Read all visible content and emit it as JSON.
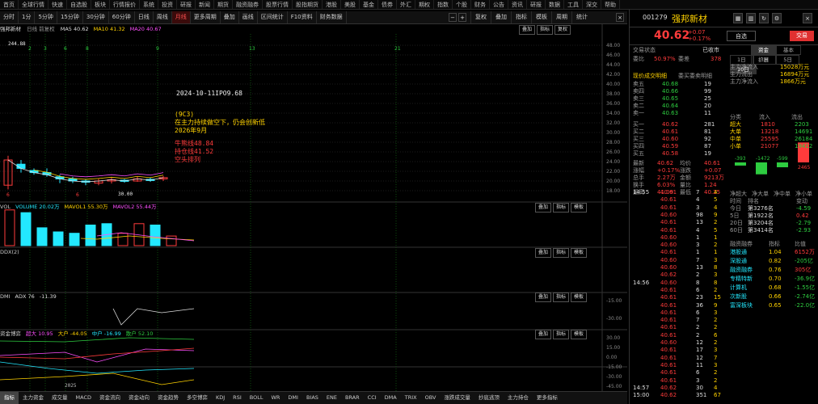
{
  "top_menu": [
    "首页",
    "全球行情",
    "快速",
    "自选股",
    "板块",
    "行情报价",
    "系统",
    "投资",
    "研报",
    "新闻",
    "期货",
    "融资融券",
    "股票行情",
    "股指期货",
    "港股",
    "美股",
    "基金",
    "债券",
    "外汇",
    "期权",
    "指数",
    "个股",
    "财务",
    "公告",
    "资讯",
    "研报",
    "数据",
    "工具",
    "深交",
    "帮助"
  ],
  "toolbar": {
    "items": [
      "分时",
      "1分",
      "5分钟",
      "15分钟",
      "30分钟",
      "60分钟",
      "日线",
      "周线",
      "月线",
      "更多周期",
      "叠加",
      "画线",
      "区间统计",
      "F10资料",
      "财务数据"
    ],
    "active_index": 8,
    "right_items": [
      "复权",
      "叠加",
      "指标",
      "模板",
      "周期",
      "统计"
    ]
  },
  "main_panel": {
    "title": "强邦新材",
    "subtitle": "日线 前复权",
    "ma_labels": [
      {
        "t": "MA5 40.62",
        "c": "#ddd"
      },
      {
        "t": "MA10 41.32",
        "c": "#ffd200"
      },
      {
        "t": "MA20 40.67",
        "c": "#ff4fff"
      }
    ],
    "right_tools": [
      "叠加",
      "指标",
      "复权"
    ],
    "price_axis": [
      "48.00",
      "46.00",
      "44.00",
      "42.00",
      "40.00",
      "38.00",
      "36.00",
      "34.00",
      "32.00",
      "30.00",
      "28.00",
      "26.00",
      "24.00",
      "22.00",
      "20.00",
      "18.00"
    ]
  },
  "annotations": {
    "ipo": "2024-10-11IPO9.68",
    "q_title": "(9C3)",
    "q_line1": "在主力持续做空下，仍会创新低",
    "q_line2": "2026年9月",
    "bear_line": "牛熊线48.84",
    "hold_line": "持仓线41.52",
    "bias": "空头排列",
    "high_label": "244.88",
    "low_label": "30.00",
    "month_markers": [
      "2",
      "3",
      "6",
      "8",
      "9",
      "13",
      "21"
    ]
  },
  "volume_panel": {
    "head": [
      {
        "t": "VOL",
        "c": "#ccc"
      },
      {
        "t": "VOLUME 20.02万",
        "c": "#23e8ff"
      },
      {
        "t": "MAVOL1 55.30万",
        "c": "#ffd200"
      },
      {
        "t": "MAVOL2 55.44万",
        "c": "#ff4fff"
      }
    ],
    "tools": [
      "叠加",
      "指标",
      "模板"
    ]
  },
  "empty_panel": {
    "head": [
      {
        "t": "DDX(2)",
        "c": "#ccc"
      }
    ],
    "tools": [
      "叠加",
      "指标",
      "模板"
    ]
  },
  "index_panel": {
    "head": [
      {
        "t": "DMI",
        "c": "#ccc"
      },
      {
        "t": "ADX 76",
        "c": "#ddd"
      },
      {
        "t": "-11.39",
        "c": "#ddd"
      }
    ],
    "tools": [
      "叠加",
      "指标",
      "模板"
    ],
    "axis": [
      "-15.00",
      "-30.00",
      "-45.00"
    ]
  },
  "fund_panel": {
    "head": [
      {
        "t": "资金博弈",
        "c": "#ccc"
      },
      {
        "t": "超大 10.95",
        "c": "#ff4fff"
      },
      {
        "t": "大户 -44.05",
        "c": "#ffd200"
      },
      {
        "t": "中户 -16.99",
        "c": "#23e8ff"
      },
      {
        "t": "散户 52.10",
        "c": "#2ecc40"
      }
    ],
    "tools": [
      "叠加",
      "指标",
      "模板"
    ],
    "axis": [
      "30.00",
      "15.00",
      "0.00",
      "-15.00",
      "-30.00",
      "-45.00"
    ],
    "year": "2025"
  },
  "bottom_tabs": [
    "指标",
    "主力资金",
    "成交量",
    "MACD",
    "资金流向",
    "资金动向",
    "资金趋势",
    "多空博弈",
    "KDJ",
    "RSI",
    "BOLL",
    "WR",
    "DMI",
    "BIAS",
    "ENE",
    "BRAR",
    "CCI",
    "DMA",
    "TRIX",
    "OBV",
    "涨跌成交量",
    "抄底逃顶",
    "主力持仓",
    "更多指标"
  ],
  "bottom_active": 0,
  "quote": {
    "code": "001279",
    "name": "强邦新材",
    "price": "40.62",
    "change": "+0.07",
    "pct": "+0.17%",
    "add_label": "自选",
    "self_label": "交易",
    "tabs": [
      "交易状态",
      "已收市"
    ],
    "tabs2": [
      "资金",
      "基本",
      "扩展"
    ],
    "stats1": [
      [
        "委比",
        "50.97%",
        "委差",
        "378"
      ]
    ],
    "mtabs": [
      "1日",
      "3日",
      "5日",
      "10日"
    ],
    "flows": [
      [
        "主力净流入",
        "15028万元"
      ],
      [
        "主力流出",
        "16894万元"
      ],
      [
        "主力净流入",
        "1866万元"
      ]
    ],
    "orders_head": [
      "分类",
      "流入",
      "流出"
    ],
    "orders": [
      [
        "超大",
        "1810",
        "2203"
      ],
      [
        "大单",
        "13218",
        "14691"
      ],
      [
        "中单",
        "25595",
        "26184"
      ],
      [
        "小单",
        "21077",
        "19412"
      ]
    ],
    "asks": [
      [
        "卖五",
        "40.68",
        "19"
      ],
      [
        "卖四",
        "40.66",
        "99"
      ],
      [
        "卖三",
        "40.65",
        "25"
      ],
      [
        "卖二",
        "40.64",
        "20"
      ],
      [
        "卖一",
        "40.63",
        "11"
      ]
    ],
    "bids": [
      [
        "买一",
        "40.62",
        "281"
      ],
      [
        "买二",
        "40.61",
        "81"
      ],
      [
        "买三",
        "40.60",
        "92"
      ],
      [
        "买四",
        "40.59",
        "87"
      ],
      [
        "买五",
        "40.58",
        "19"
      ]
    ],
    "book_head": "现价成交明细",
    "book_sub": "委买委卖明细",
    "details": [
      [
        "最新",
        "40.62",
        "均价",
        "40.61"
      ],
      [
        "涨幅",
        "+0.17%",
        "涨跌",
        "+0.07"
      ],
      [
        "总手",
        "2.27万",
        "金额",
        "9213万"
      ],
      [
        "换手",
        "6.03%",
        "量比",
        "1.24"
      ],
      [
        "最高",
        "41.09",
        "最低",
        "40.25"
      ]
    ],
    "bar_values": [
      "-393",
      "-1472",
      "-599",
      "2465"
    ],
    "bar_caption": [
      "净超大",
      "净大单",
      "净中单",
      "净小单"
    ],
    "ranks_head": [
      "时间",
      "排名",
      "变动"
    ],
    "ranks": [
      [
        "今日",
        "第3276名",
        "-4.59"
      ],
      [
        "5日",
        "第1922名",
        "0.42"
      ],
      [
        "20日",
        "第3204名",
        "-2.79"
      ],
      [
        "60日",
        "第3414名",
        "-2.93"
      ]
    ],
    "ranks_colors": [
      "g",
      "r",
      "g",
      "g"
    ],
    "ratio_head": [
      "融资融券",
      "指标",
      "比值"
    ],
    "ratio_rows": [
      [
        "港股通",
        "1.04",
        "6152万"
      ],
      [
        "深股通",
        "0.82",
        "-205亿"
      ],
      [
        "融资融券",
        "0.76",
        "305亿"
      ],
      [
        "专精特新",
        "0.70",
        "-36.9亿"
      ],
      [
        "计算机",
        "0.68",
        "-1.55亿"
      ],
      [
        "次新股",
        "0.66",
        "-2.74亿"
      ],
      [
        "富深板块",
        "0.65",
        "-22.0亿"
      ]
    ],
    "ticks": [
      [
        "14:55",
        "40.61",
        "7",
        "4"
      ],
      [
        "",
        "40.61",
        "4",
        "5"
      ],
      [
        "",
        "40.61",
        "3",
        "4"
      ],
      [
        "",
        "40.60",
        "98",
        "9"
      ],
      [
        "",
        "40.61",
        "13",
        "2"
      ],
      [
        "",
        "40.61",
        "4",
        "5"
      ],
      [
        "",
        "40.60",
        "1",
        "1"
      ],
      [
        "",
        "40.60",
        "3",
        "2"
      ],
      [
        "",
        "40.61",
        "1",
        "1"
      ],
      [
        "",
        "40.60",
        "7",
        "3"
      ],
      [
        "",
        "40.60",
        "13",
        "8"
      ],
      [
        "",
        "40.62",
        "2",
        "3"
      ],
      [
        "14:56",
        "40.60",
        "8",
        "8"
      ],
      [
        "",
        "40.61",
        "6",
        "2"
      ],
      [
        "",
        "40.61",
        "23",
        "15"
      ],
      [
        "",
        "40.61",
        "36",
        "9"
      ],
      [
        "",
        "40.61",
        "6",
        "3"
      ],
      [
        "",
        "40.61",
        "7",
        "2"
      ],
      [
        "",
        "40.61",
        "2",
        "2"
      ],
      [
        "",
        "40.61",
        "2",
        "6"
      ],
      [
        "",
        "40.60",
        "12",
        "2"
      ],
      [
        "",
        "40.61",
        "17",
        "3"
      ],
      [
        "",
        "40.61",
        "12",
        "7"
      ],
      [
        "",
        "40.61",
        "11",
        "3"
      ],
      [
        "",
        "40.61",
        "6",
        "2"
      ],
      [
        "",
        "40.61",
        "3",
        "2"
      ],
      [
        "14:57",
        "40.62",
        "30",
        "4"
      ],
      [
        "15:00",
        "40.62",
        "351",
        "67"
      ]
    ]
  },
  "chart_data": {
    "type": "candlestick",
    "candles": [
      [
        18,
        24,
        17,
        25
      ],
      [
        23,
        22,
        21,
        24
      ],
      [
        21.5,
        21,
        20.5,
        22
      ],
      [
        21,
        20.5,
        20,
        22
      ],
      [
        20,
        19.5,
        18.5,
        20.5
      ],
      [
        19.5,
        19,
        18.5,
        20
      ],
      [
        19,
        18.8,
        18,
        19.5
      ],
      [
        18.5,
        19,
        18,
        19.6
      ],
      [
        19,
        19.3,
        18.4,
        19.8
      ],
      [
        19.2,
        19,
        18.6,
        19.5
      ],
      [
        19,
        19.5,
        18.8,
        20
      ],
      [
        19.4,
        19.2,
        18.8,
        19.9
      ],
      [
        19.5,
        19.8,
        19,
        20.2
      ]
    ],
    "volume": [
      26,
      24,
      13,
      10,
      9,
      15,
      16,
      9,
      16,
      15,
      7
    ]
  }
}
